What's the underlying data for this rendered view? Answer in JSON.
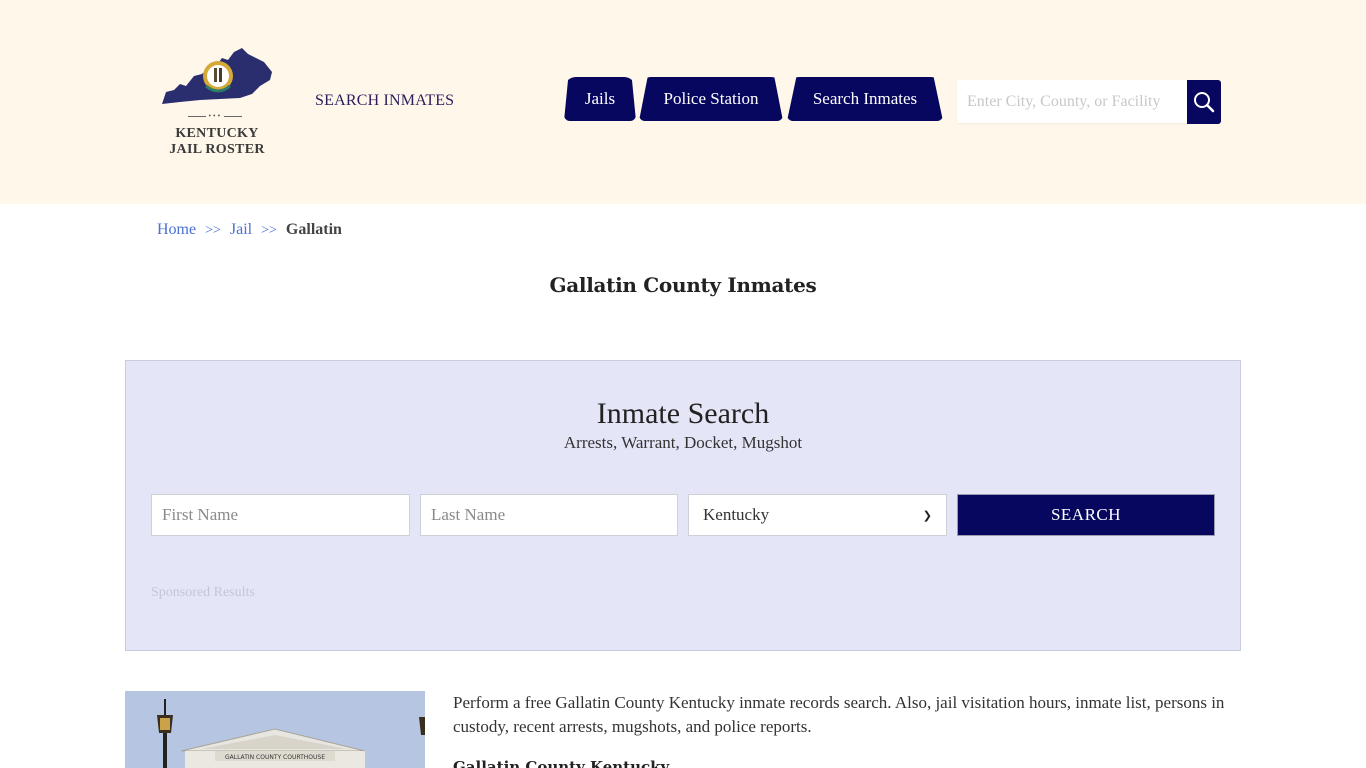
{
  "header": {
    "logo_text_line1": "KENTUCKY",
    "logo_text_line2": "JAIL ROSTER",
    "logo_dots": "•••",
    "search_inmates_link": "SEARCH INMATES",
    "nav": [
      {
        "label": "Jails"
      },
      {
        "label": "Police Station"
      },
      {
        "label": "Search Inmates"
      }
    ],
    "search": {
      "placeholder": "Enter City, County, or Facility",
      "value": "",
      "button_icon": "search-icon"
    },
    "colors": {
      "background": "#fff8ea",
      "nav_bg": "#07075f"
    }
  },
  "breadcrumb": {
    "items": [
      {
        "label": "Home"
      },
      {
        "label": "Jail"
      },
      {
        "label": "Gallatin"
      }
    ],
    "separator": ">>"
  },
  "page_title": "Gallatin County Inmates",
  "inmate_search": {
    "title": "Inmate Search",
    "subtitle": "Arrests, Warrant, Docket, Mugshot",
    "first_name": {
      "placeholder": "First Name",
      "value": ""
    },
    "last_name": {
      "placeholder": "Last Name",
      "value": ""
    },
    "state_select": {
      "selected": "Kentucky"
    },
    "search_button": "SEARCH",
    "sponsored_label": "Sponsored Results",
    "colors": {
      "panel_bg": "#e4e6f7",
      "button_bg": "#07075f"
    }
  },
  "content": {
    "image_caption": "GALLATIN COUNTY COURTHOUSE",
    "intro": "Perform a free Gallatin County Kentucky inmate records search. Also, jail visitation hours, inmate list, persons in custody, recent arrests, mugshots, and police reports.",
    "subheading": "Gallatin County Kentucky"
  }
}
